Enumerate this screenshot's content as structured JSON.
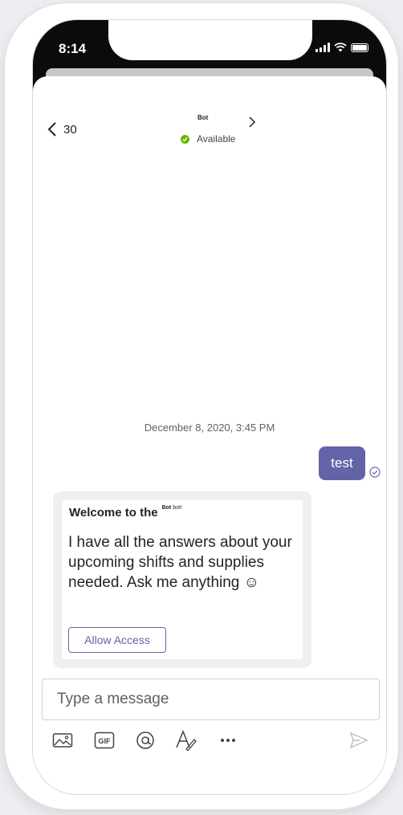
{
  "status_bar": {
    "time": "8:14"
  },
  "header": {
    "back_count": "30",
    "bot_name": "Bot",
    "presence": "Available"
  },
  "conversation": {
    "timestamp": "December 8, 2020, 3:45 PM",
    "sent_message": "test",
    "card": {
      "title": "Welcome to the",
      "title_bot": "Bot",
      "title_suffix": "bot!",
      "body": "I have all the answers about your upcoming shifts and supplies needed.  Ask me anything ☺",
      "button_label": "Allow Access"
    }
  },
  "composer": {
    "placeholder": "Type a message",
    "tools": [
      "image-icon",
      "gif-icon",
      "mention-icon",
      "format-icon",
      "more-icon",
      "send-icon"
    ]
  },
  "colors": {
    "accent": "#6264a7",
    "presence_available": "#6bb700",
    "status_bar": "#0b0b0c"
  }
}
